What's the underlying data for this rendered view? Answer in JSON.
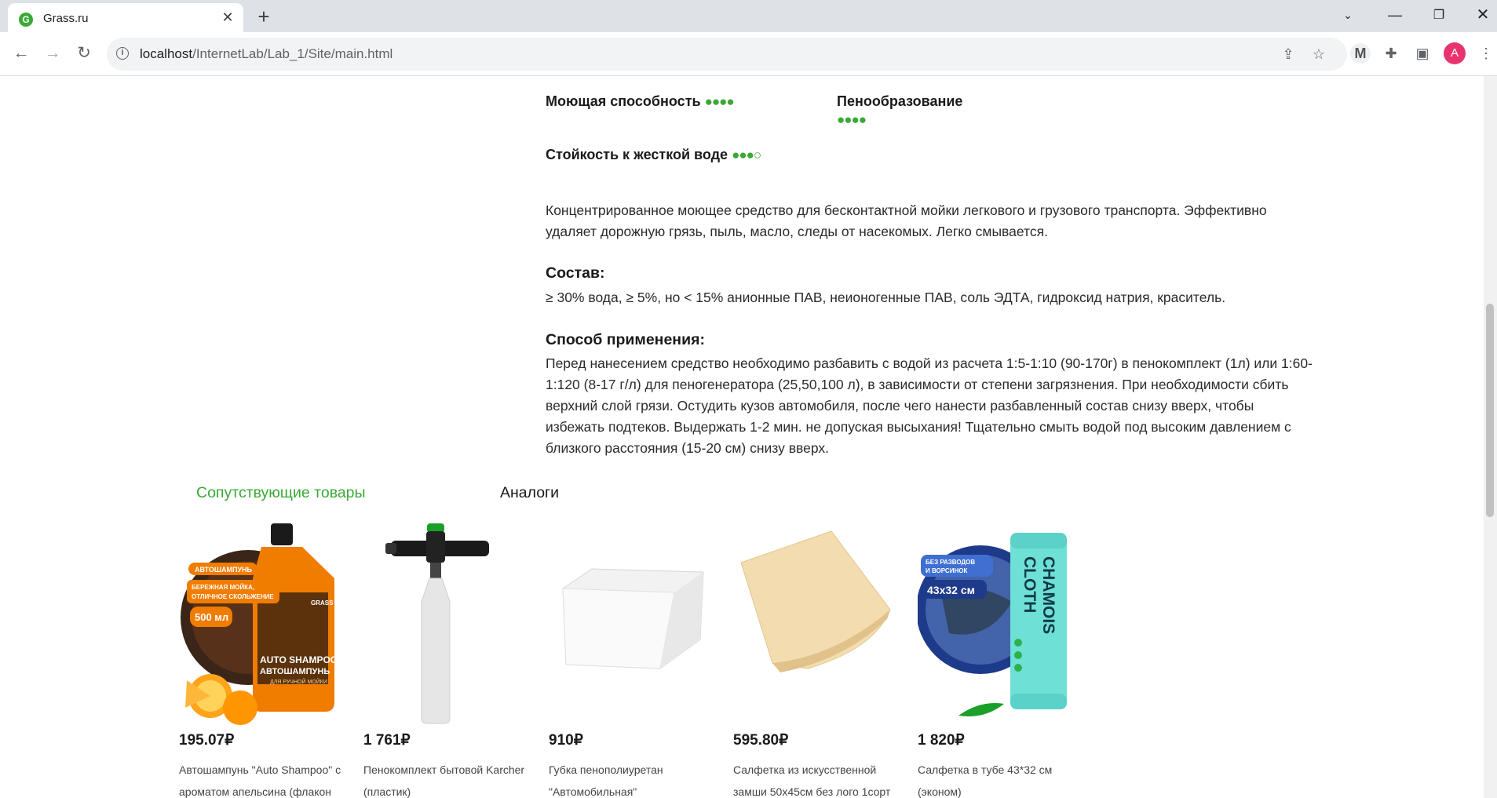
{
  "browser": {
    "tab_title": "Grass.ru",
    "favicon_letter": "G",
    "url_host": "localhost",
    "url_path": "/InternetLab/Lab_1/Site/main.html",
    "avatar_letter": "A"
  },
  "properties": {
    "washing": {
      "label": "Моющая способность",
      "dots": "●●●●",
      "rating": 4
    },
    "foaming": {
      "label": "Пенообразование",
      "dots": "●●●●",
      "rating": 4
    },
    "hard_water": {
      "label": "Стойкость к жесткой воде",
      "dots": "●●●",
      "empty_dot": "○",
      "rating": 3
    }
  },
  "description": "Концентрированное моющее средство для бесконтактной мойки легкового и грузового транспорта. Эффективно удаляет дорожную грязь, пыль, масло, следы от насекомых. Легко смывается.",
  "composition": {
    "title": "Состав:",
    "text": "≥ 30% вода, ≥ 5%, но < 15% анионные ПАВ, неионогенные ПАВ, соль ЭДТА, гидроксид натрия, краситель."
  },
  "usage": {
    "title": "Способ применения:",
    "text": "Перед нанесением средство необходимо разбавить с водой из расчета 1:5-1:10 (90-170г) в пенокомплект (1л) или 1:60-1:120 (8-17 г/л) для пеногенератора (25,50,100 л), в зависимости от степени загрязнения. При необходимости сбить верхний слой грязи. Остудить кузов автомобиля, после чего нанести разбавленный состав снизу вверх, чтобы избежать подтеков. Выдержать 1-2 мин. не допуская высыхания! Тщательно смыть водой под высоким давлением с близкого расстояния (15-20 см) снизу вверх."
  },
  "product_tabs": {
    "related": "Сопутствующие товары",
    "analogs": "Аналоги"
  },
  "products": [
    {
      "price": "195.07₽",
      "name": "Автошампунь \"Auto Shampoo\" с ароматом апельсина (флакон"
    },
    {
      "price": "1 761₽",
      "name": "Пенокомплект бытовой Karcher (пластик)"
    },
    {
      "price": "910₽",
      "name": "Губка пенополиуретан \"Автомобильная\""
    },
    {
      "price": "595.80₽",
      "name": "Салфетка из искусственной замши 50х45см без лого 1сорт"
    },
    {
      "price": "1 820₽",
      "name": "Салфетка в тубе 43*32 см (эконом)"
    }
  ],
  "product_image_text": {
    "shampoo_badge1": "АВТОШАМПУНЬ",
    "shampoo_badge2a": "БЕРЕЖНАЯ МОЙКА,",
    "shampoo_badge2b": "ОТЛИЧНОЕ СКОЛЬЖЕНИЕ",
    "shampoo_volume": "500 мл",
    "shampoo_brand": "GRASS",
    "shampoo_label1": "AUTO SHAMPOO",
    "shampoo_label2": "АВТОШАМПУНЬ",
    "shampoo_label3": "ДЛЯ РУЧНОЙ МОЙКИ",
    "cloth_badge1": "БЕЗ РАЗВОДОВ",
    "cloth_badge2": "И ВОРСИНОК",
    "cloth_size": "43x32 см",
    "cloth_tube1": "CHAMOIS",
    "cloth_tube2": "CLOTH"
  },
  "colors": {
    "accent_green": "#3aa935",
    "shampoo_orange": "#f07c00",
    "cloth_blue": "#1e3a8a",
    "cloth_teal": "#6ee0d6",
    "chamois_beige": "#f3ddb0"
  }
}
